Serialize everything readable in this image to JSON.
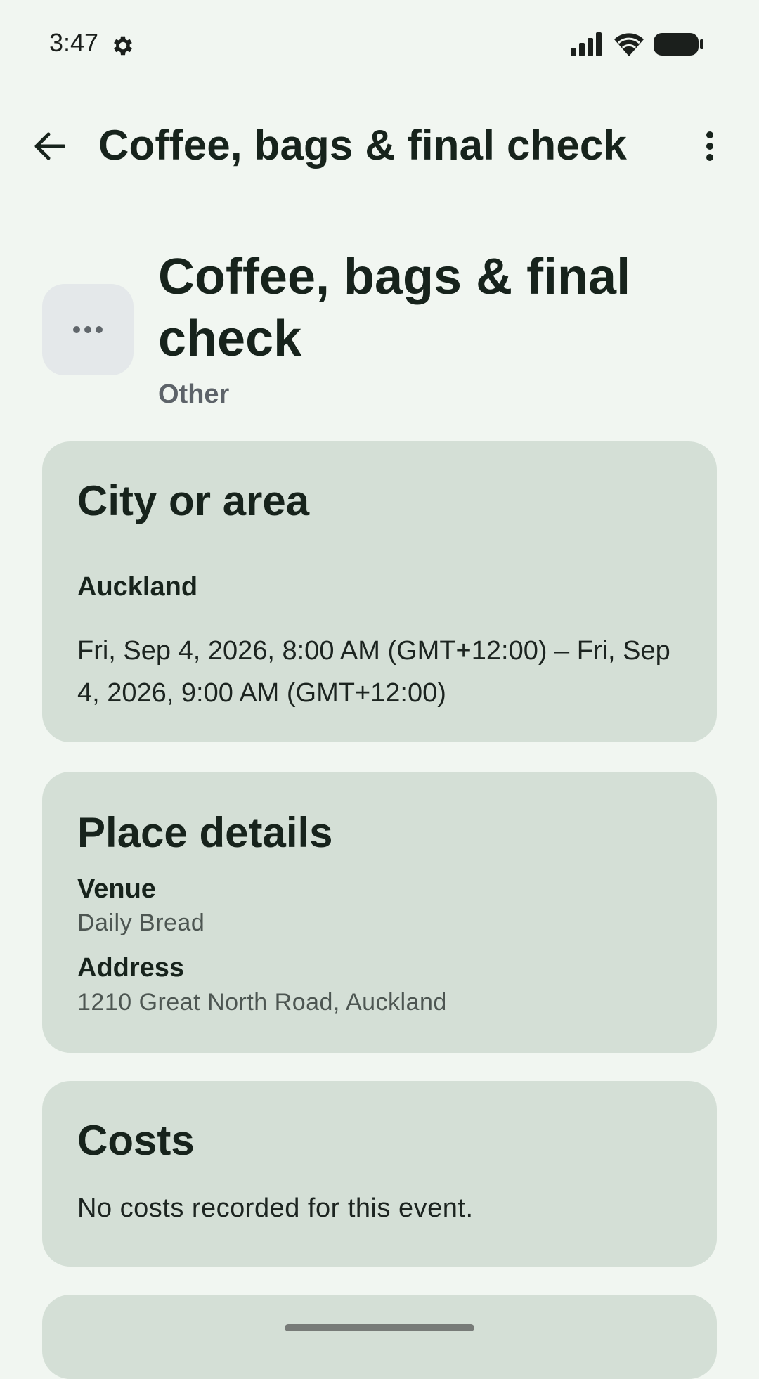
{
  "status_bar": {
    "time": "3:47",
    "icons": [
      "gear-icon",
      "signal-icon",
      "wifi-icon",
      "battery-icon"
    ]
  },
  "app_bar": {
    "title": "Coffee, bags & final check",
    "icons": [
      "back-arrow-icon",
      "more-vert-icon"
    ]
  },
  "event": {
    "title": "Coffee, bags & final check",
    "category": "Other",
    "icon": "more-horiz-icon"
  },
  "city_card": {
    "heading": "City or area",
    "city": "Auckland",
    "time_range": "Fri, Sep 4, 2026, 8:00 AM (GMT+12:00) – Fri, Sep 4, 2026, 9:00 AM (GMT+12:00)"
  },
  "place_card": {
    "heading": "Place details",
    "venue_label": "Venue",
    "venue_value": "Daily Bread",
    "address_label": "Address",
    "address_value": "1210 Great North Road, Auckland"
  },
  "costs_card": {
    "heading": "Costs",
    "text": "No costs recorded for this event."
  },
  "colors": {
    "background": "#f1f6f1",
    "card": "#d4dfd6",
    "icon_tile": "#e4e8ea",
    "text_primary": "#17231c",
    "text_secondary": "#5d6369"
  }
}
